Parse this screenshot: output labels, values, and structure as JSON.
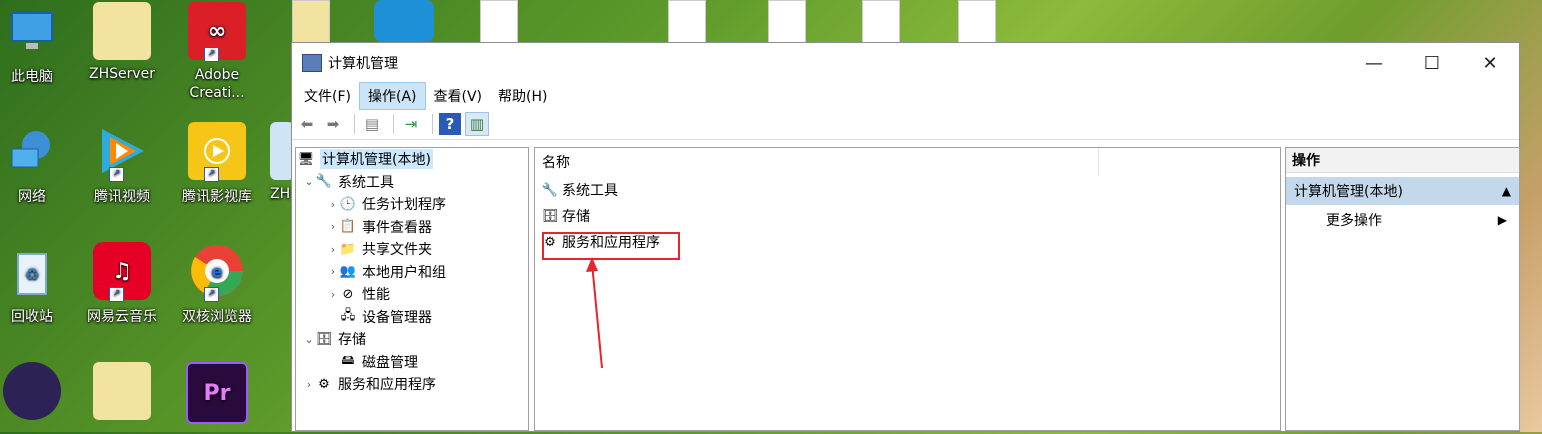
{
  "desktop": {
    "icons": [
      {
        "label": "此电脑"
      },
      {
        "label": "ZHServer"
      },
      {
        "label": "Adobe Creati..."
      },
      {
        "label": "网络"
      },
      {
        "label": "腾讯视频"
      },
      {
        "label": "腾讯影视库"
      },
      {
        "label": "ZH"
      },
      {
        "label": "回收站"
      },
      {
        "label": "网易云音乐"
      },
      {
        "label": "双核浏览器"
      },
      {
        "label": "Pr"
      }
    ]
  },
  "window": {
    "title": "计算机管理",
    "controls": {
      "minimize": "—",
      "maximize": "☐",
      "close": "✕"
    }
  },
  "menu": {
    "items": [
      "文件(F)",
      "操作(A)",
      "查看(V)",
      "帮助(H)"
    ],
    "active_index": 1
  },
  "tree": {
    "root": "计算机管理(本地)",
    "system_tools": "系统工具",
    "task_scheduler": "任务计划程序",
    "event_viewer": "事件查看器",
    "shared_folders": "共享文件夹",
    "local_users": "本地用户和组",
    "performance": "性能",
    "device_manager": "设备管理器",
    "storage": "存储",
    "disk_management": "磁盘管理",
    "services_apps": "服务和应用程序"
  },
  "list": {
    "header_name": "名称",
    "rows": [
      "系统工具",
      "存储",
      "服务和应用程序"
    ]
  },
  "actions": {
    "header": "操作",
    "section": "计算机管理(本地)",
    "more": "更多操作"
  },
  "colors": {
    "highlight_box": "#e3262f",
    "selection": "#cce8ff",
    "action_section": "#c4d8ec"
  }
}
